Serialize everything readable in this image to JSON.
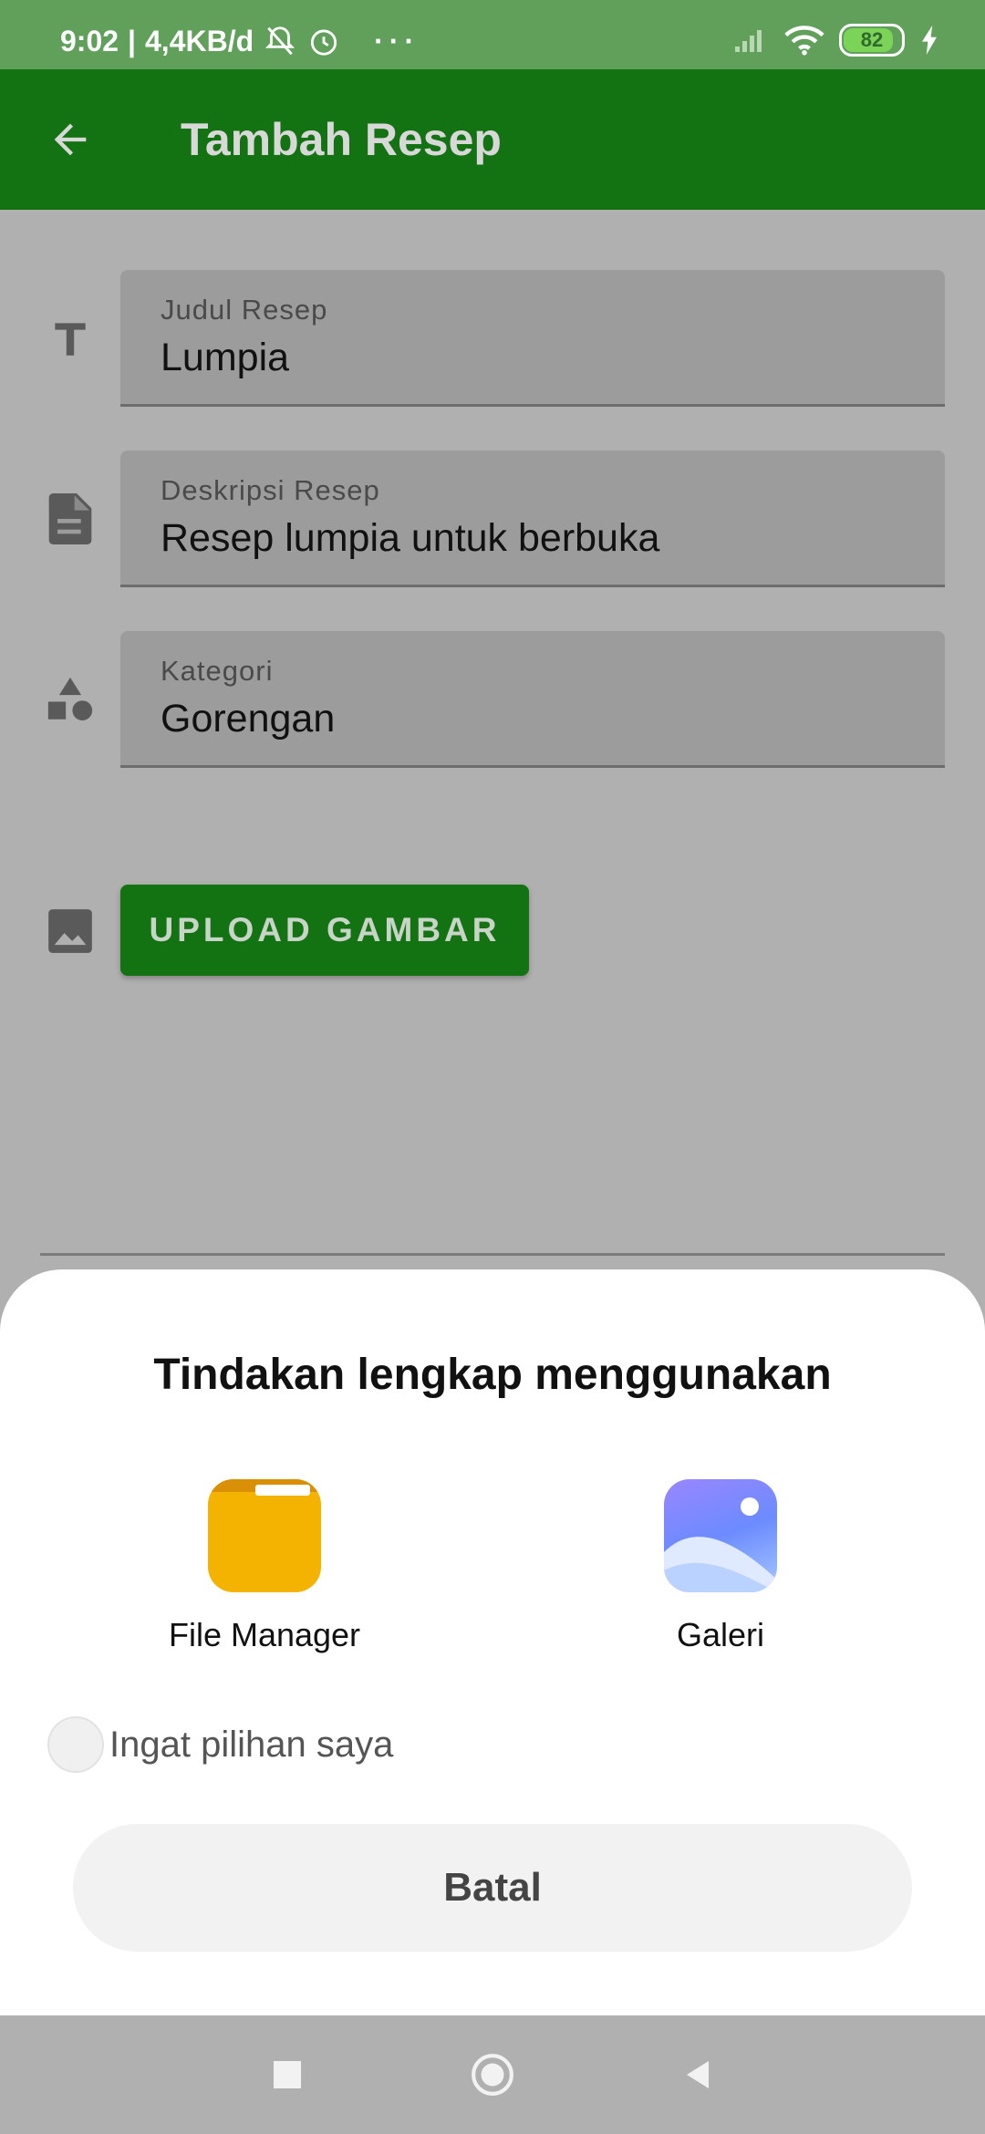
{
  "status_bar": {
    "time": "9:02",
    "network_speed": "4,4KB/d",
    "more": "···",
    "battery_level": "82",
    "icons": [
      "mute-icon",
      "alarm-icon",
      "signal-icon",
      "wifi-icon",
      "battery-icon",
      "charging-icon"
    ]
  },
  "app_bar": {
    "title": "Tambah Resep",
    "back_icon": "arrow-left-icon"
  },
  "form": {
    "title_field": {
      "label": "Judul Resep",
      "value": "Lumpia",
      "icon": "text-icon"
    },
    "description_field": {
      "label": "Deskripsi Resep",
      "value": "Resep lumpia untuk berbuka",
      "icon": "document-icon"
    },
    "category_field": {
      "label": "Kategori",
      "value": "Gorengan",
      "icon": "shapes-icon"
    },
    "upload": {
      "label": "UPLOAD GAMBAR",
      "icon": "image-icon"
    }
  },
  "chooser_sheet": {
    "title": "Tindakan lengkap menggunakan",
    "apps": [
      {
        "label": "File Manager",
        "icon": "file-manager-icon"
      },
      {
        "label": "Galeri",
        "icon": "gallery-icon"
      }
    ],
    "remember_label": "Ingat pilihan saya",
    "remember_checked": false,
    "cancel_label": "Batal"
  },
  "colors": {
    "app_bar": "#137312",
    "status_bar": "#60a05a",
    "scrim_background": "#b0b0b0",
    "sheet_background": "#ffffff",
    "file_manager_icon": "#f3b300"
  }
}
